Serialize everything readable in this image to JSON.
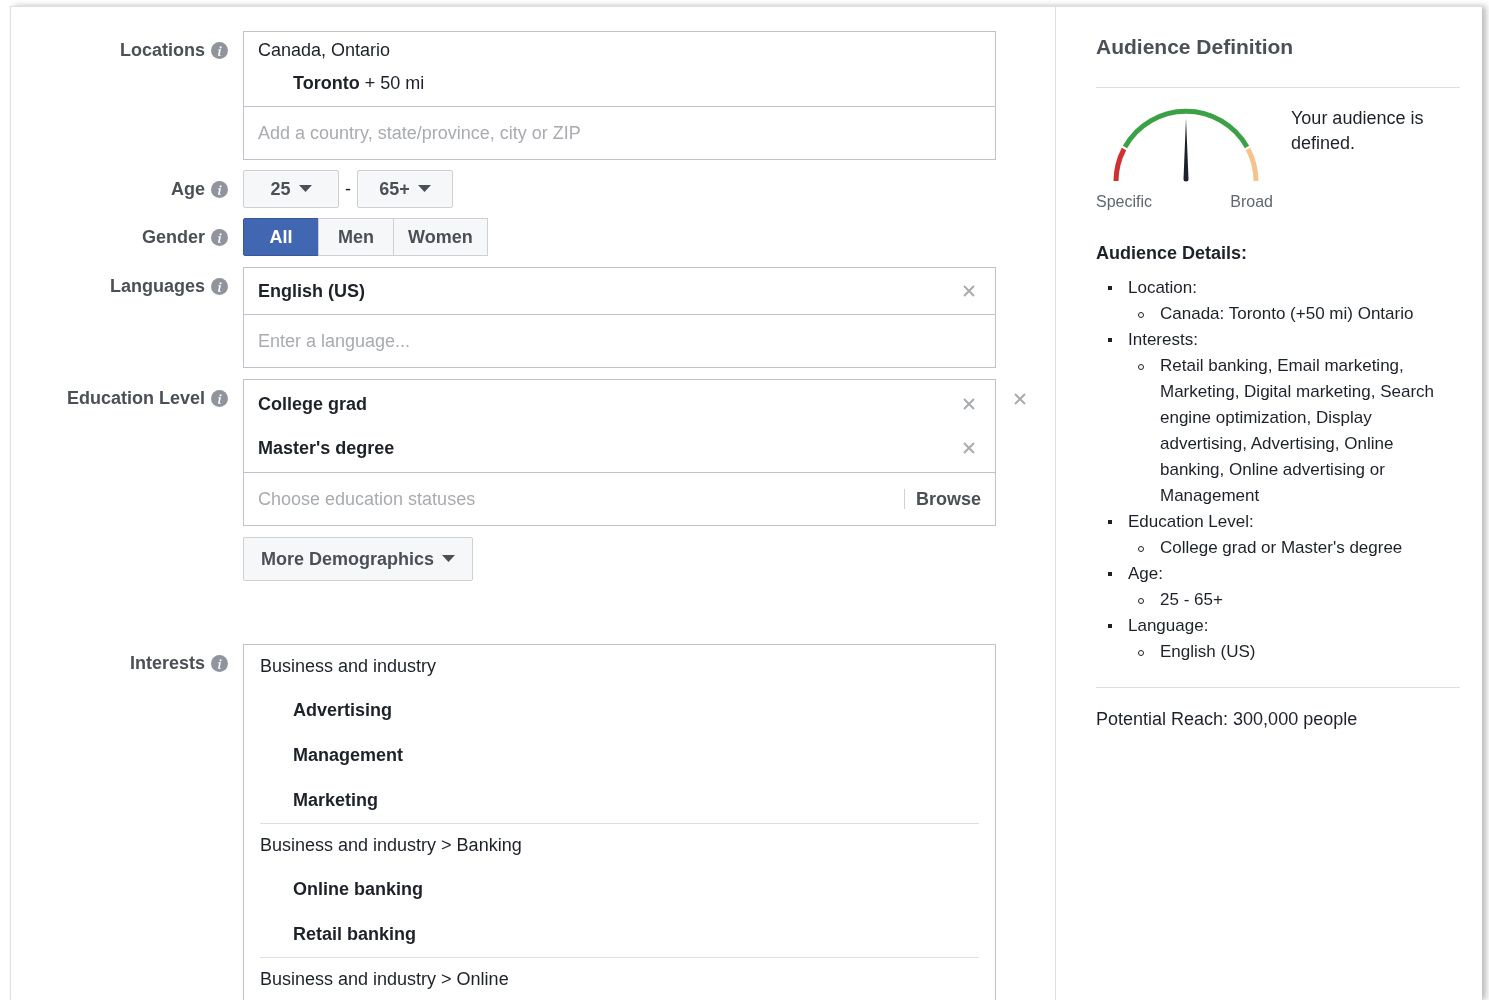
{
  "targeting": {
    "locations": {
      "label": "Locations",
      "region": "Canada, Ontario",
      "cities": [
        {
          "name": "Toronto",
          "radius": "+ 50 mi"
        }
      ],
      "placeholder": "Add a country, state/province, city or ZIP"
    },
    "age": {
      "label": "Age",
      "from": "25",
      "separator": "-",
      "to": "65+"
    },
    "gender": {
      "label": "Gender",
      "options": [
        {
          "label": "All",
          "selected": true
        },
        {
          "label": "Men",
          "selected": false
        },
        {
          "label": "Women",
          "selected": false
        }
      ]
    },
    "languages": {
      "label": "Languages",
      "items": [
        "English (US)"
      ],
      "placeholder": "Enter a language..."
    },
    "education": {
      "label": "Education Level",
      "items": [
        "College grad",
        "Master's degree"
      ],
      "placeholder": "Choose education statuses",
      "browse": "Browse"
    },
    "more_demographics": "More Demographics",
    "interests": {
      "label": "Interests",
      "groups": [
        {
          "path": "Business and industry",
          "items": [
            "Advertising",
            "Management",
            "Marketing"
          ]
        },
        {
          "path": "Business and industry > Banking",
          "items": [
            "Online banking",
            "Retail banking"
          ]
        },
        {
          "path": "Business and industry > Online"
        }
      ]
    }
  },
  "audience": {
    "title": "Audience Definition",
    "gauge": {
      "min_label": "Specific",
      "max_label": "Broad"
    },
    "status": "Your audience is defined.",
    "details_title": "Audience Details:",
    "details": [
      {
        "label": "Location:",
        "values": [
          "Canada: Toronto (+50 mi) Ontario"
        ]
      },
      {
        "label": "Interests:",
        "values": [
          "Retail banking, Email marketing, Marketing, Digital marketing, Search engine optimization, Display advertising, Advertising, Online banking, Online advertising or Management"
        ]
      },
      {
        "label": "Education Level:",
        "values": [
          "College grad or Master's degree"
        ]
      },
      {
        "label": "Age:",
        "values": [
          "25 - 65+"
        ]
      },
      {
        "label": "Language:",
        "values": [
          "English (US)"
        ]
      }
    ],
    "reach": "Potential Reach: 300,000 people"
  }
}
